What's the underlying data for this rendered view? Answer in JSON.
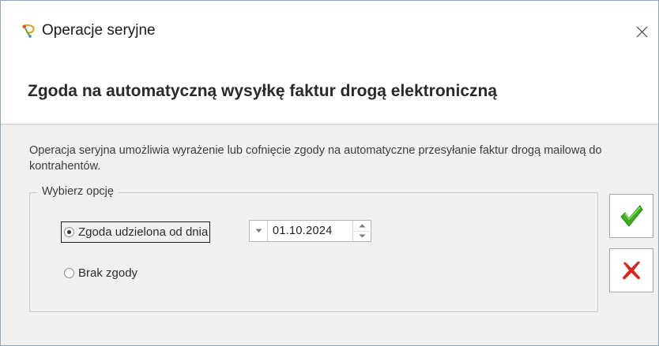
{
  "window": {
    "title": "Operacje seryjne",
    "close_glyph": "×"
  },
  "header": {
    "title": "Zgoda na automatyczną wysyłkę faktur drogą elektroniczną"
  },
  "main": {
    "description": "Operacja seryjna umożliwia wyrażenie lub cofnięcie zgody na automatyczne przesyłanie faktur drogą mailową do kontrahentów.",
    "group": {
      "label": "Wybierz opcję",
      "options": [
        {
          "label": "Zgoda udzielona od dnia",
          "checked": true
        },
        {
          "label": "Brak zgody",
          "checked": false
        }
      ],
      "date": {
        "value": "01.10.2024",
        "dropdown_glyph": "▾",
        "spin_up_glyph": "▲",
        "spin_down_glyph": "▼"
      }
    }
  },
  "actions": {
    "ok_icon": "checkmark-icon",
    "cancel_icon": "red-x-icon"
  },
  "colors": {
    "accent_green": "#3fae1d",
    "cancel_red": "#d9261c",
    "window_border": "#8fa4bf"
  }
}
